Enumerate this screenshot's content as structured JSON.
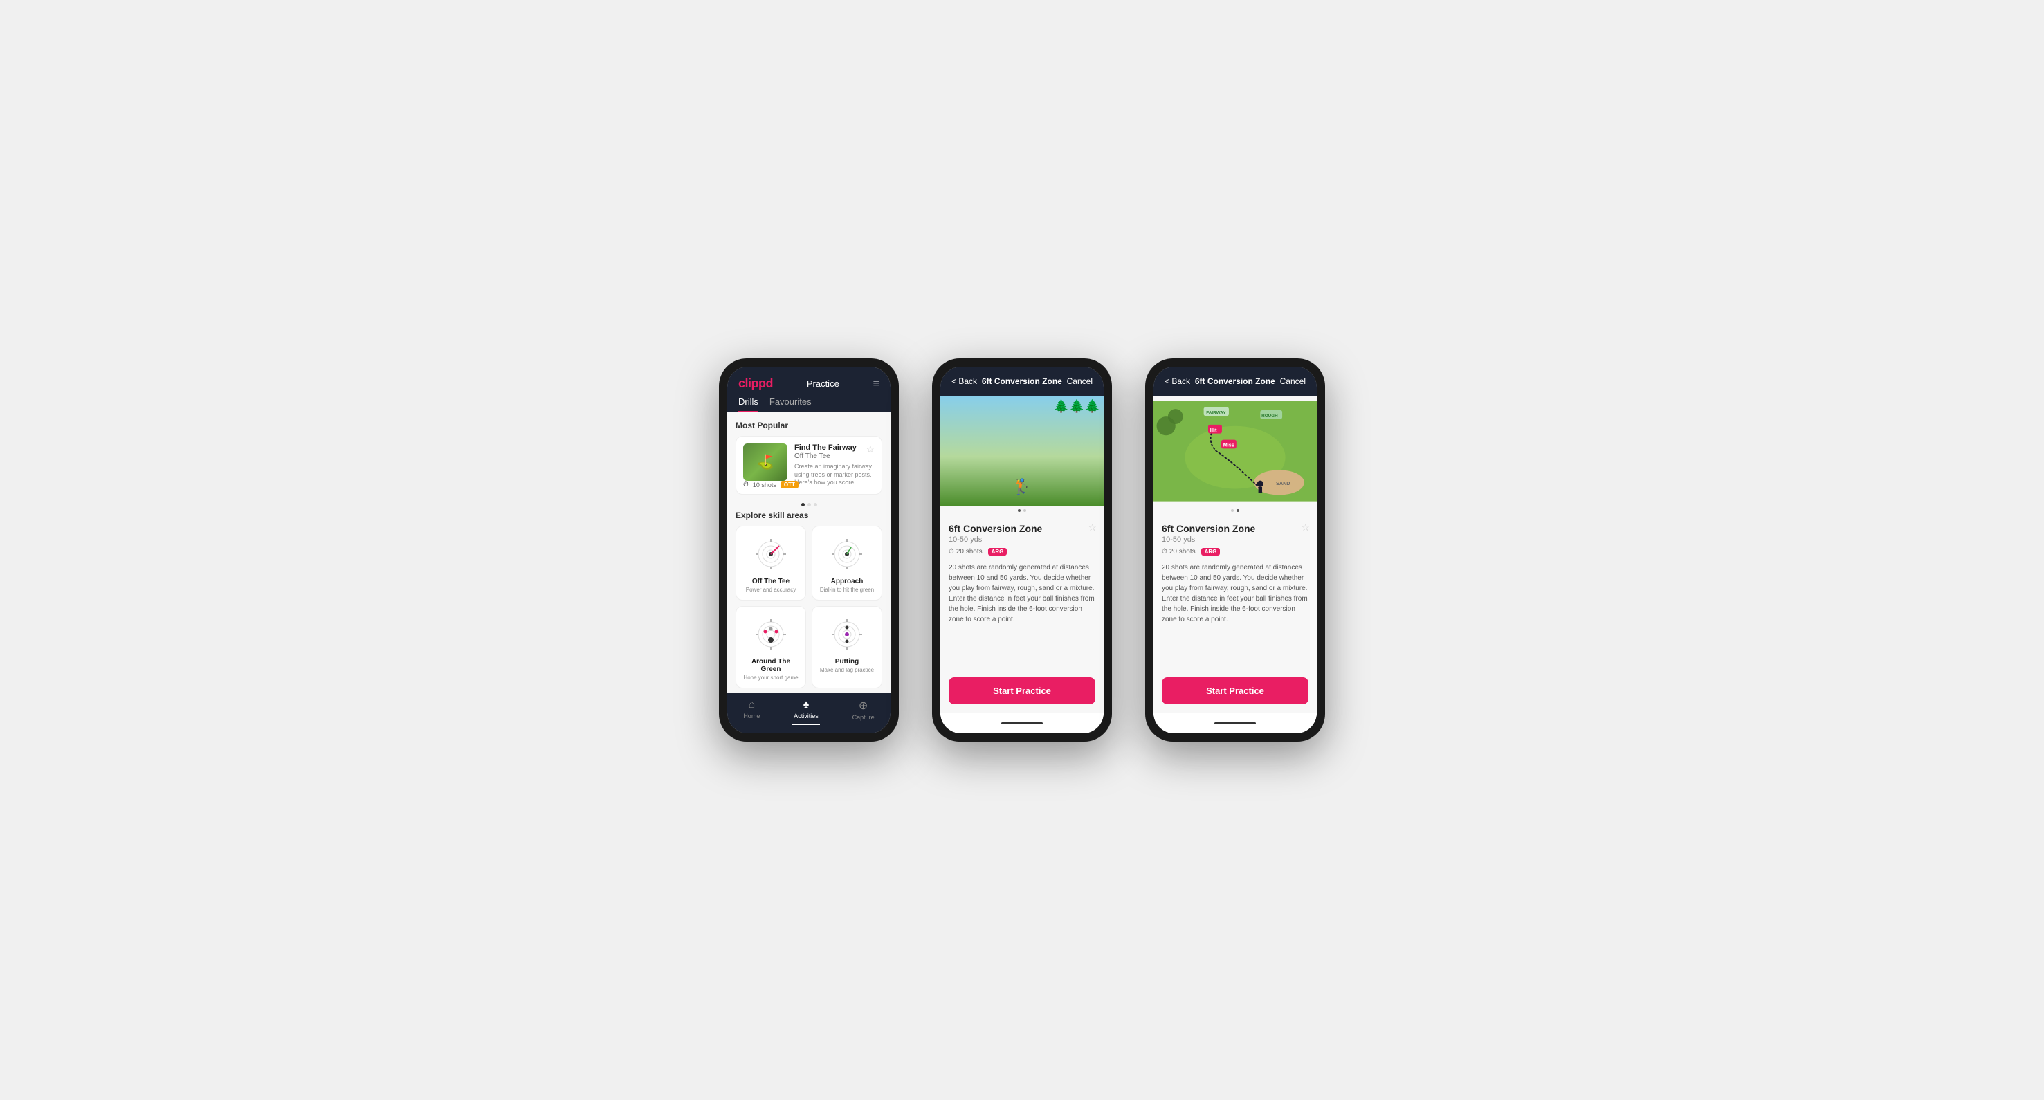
{
  "phones": {
    "phone1": {
      "header": {
        "logo": "clippd",
        "title": "Practice",
        "menu_icon": "≡"
      },
      "tabs": [
        {
          "label": "Drills",
          "active": true
        },
        {
          "label": "Favourites",
          "active": false
        }
      ],
      "most_popular_label": "Most Popular",
      "featured_drill": {
        "title": "Find The Fairway",
        "subtitle": "Off The Tee",
        "description": "Create an imaginary fairway using trees or marker posts. Here's how you score...",
        "shots": "10 shots",
        "tag": "OTT"
      },
      "explore_label": "Explore skill areas",
      "skill_areas": [
        {
          "name": "Off The Tee",
          "desc": "Power and accuracy"
        },
        {
          "name": "Approach",
          "desc": "Dial-in to hit the green"
        },
        {
          "name": "Around The Green",
          "desc": "Hone your short game"
        },
        {
          "name": "Putting",
          "desc": "Make and lag practice"
        }
      ],
      "nav": [
        {
          "label": "Home",
          "icon": "⌂",
          "active": false
        },
        {
          "label": "Activities",
          "icon": "♠",
          "active": true
        },
        {
          "label": "Capture",
          "icon": "⊕",
          "active": false
        }
      ]
    },
    "phone2": {
      "header": {
        "back_label": "< Back",
        "title": "6ft Conversion Zone",
        "cancel_label": "Cancel"
      },
      "drill": {
        "title": "6ft Conversion Zone",
        "yards": "10-50 yds",
        "shots": "20 shots",
        "tag": "ARG",
        "description": "20 shots are randomly generated at distances between 10 and 50 yards. You decide whether you play from fairway, rough, sand or a mixture. Enter the distance in feet your ball finishes from the hole. Finish inside the 6-foot conversion zone to score a point.",
        "start_btn": "Start Practice"
      }
    },
    "phone3": {
      "header": {
        "back_label": "< Back",
        "title": "6ft Conversion Zone",
        "cancel_label": "Cancel"
      },
      "drill": {
        "title": "6ft Conversion Zone",
        "yards": "10-50 yds",
        "shots": "20 shots",
        "tag": "ARG",
        "description": "20 shots are randomly generated at distances between 10 and 50 yards. You decide whether you play from fairway, rough, sand or a mixture. Enter the distance in feet your ball finishes from the hole. Finish inside the 6-foot conversion zone to score a point.",
        "start_btn": "Start Practice"
      }
    }
  }
}
